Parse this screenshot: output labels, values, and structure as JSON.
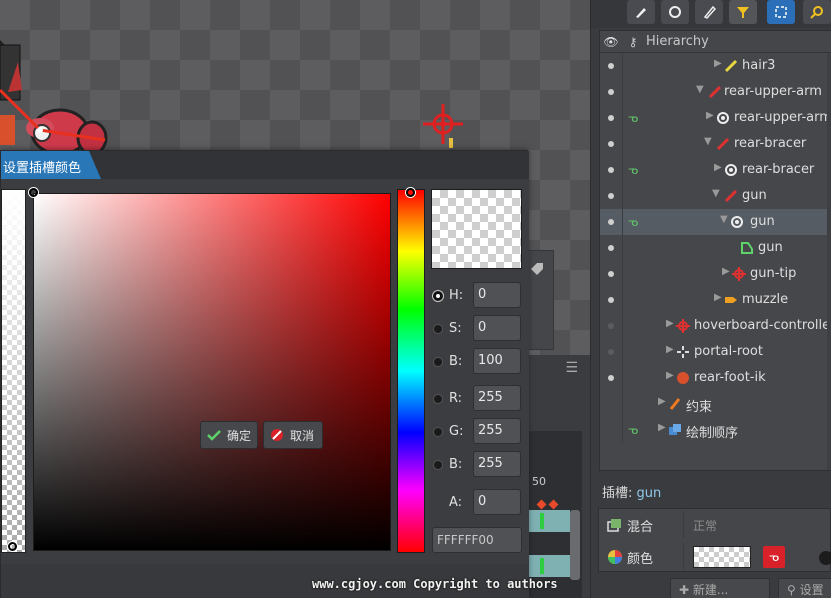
{
  "hierarchy": {
    "title": "Hierarchy",
    "rows": [
      {
        "label": "hair3"
      },
      {
        "label": "rear-upper-arm"
      },
      {
        "label": "rear-upper-arm"
      },
      {
        "label": "rear-bracer"
      },
      {
        "label": "rear-bracer"
      },
      {
        "label": "gun"
      },
      {
        "label": "gun"
      },
      {
        "label": "gun"
      },
      {
        "label": "gun-tip"
      },
      {
        "label": "muzzle"
      },
      {
        "label": "hoverboard-controller"
      },
      {
        "label": "portal-root"
      },
      {
        "label": "rear-foot-ik"
      },
      {
        "label": "约束"
      },
      {
        "label": "绘制顺序"
      }
    ]
  },
  "slot": {
    "label_prefix": "插槽:",
    "name": "gun",
    "blend_key": "混合",
    "blend_value": "正常",
    "color_key": "颜色"
  },
  "bottom_buttons": {
    "new": "新建...",
    "settings": "设置"
  },
  "timeline": {
    "frame": "50"
  },
  "dialog": {
    "title": "设置插槽颜色",
    "fields": {
      "h": {
        "label": "H:",
        "value": "0"
      },
      "s": {
        "label": "S:",
        "value": "0"
      },
      "b": {
        "label": "B:",
        "value": "100"
      },
      "r": {
        "label": "R:",
        "value": "255"
      },
      "g": {
        "label": "G:",
        "value": "255"
      },
      "bl": {
        "label": "B:",
        "value": "255"
      },
      "a": {
        "label": "A:",
        "value": "0"
      }
    },
    "hex": "FFFFFF00",
    "ok_label": "确定",
    "cancel_label": "取消"
  },
  "watermark": "www.cgjoy.com Copyright to authors",
  "colors": {
    "accent": "#2a77b8",
    "selection": "#565c63",
    "key_red": "#d9212a"
  }
}
